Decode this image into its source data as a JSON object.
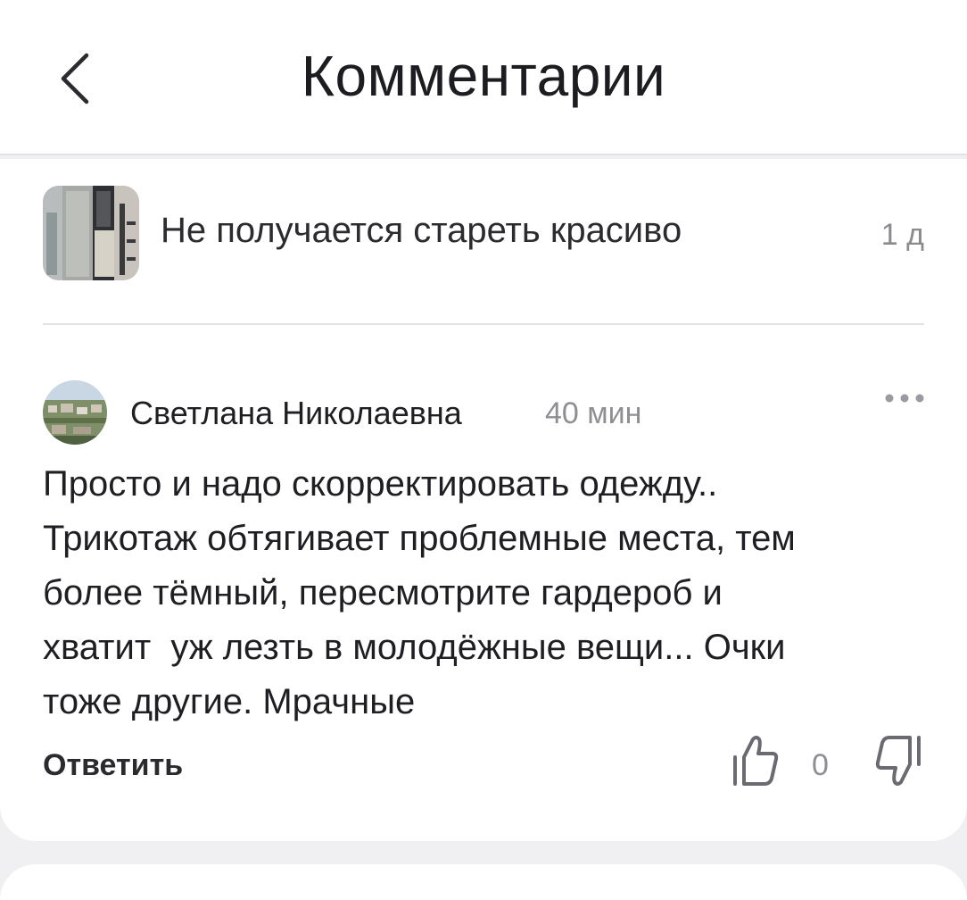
{
  "header": {
    "title": "Комментарии",
    "back_icon": "chevron-left-icon"
  },
  "article": {
    "title": "Не получается стареть красиво",
    "age": "1 д",
    "thumbnail": "article-thumbnail"
  },
  "comment": {
    "author": "Светлана Николаевна",
    "time": "40 мин",
    "text": "Просто и надо скорректировать одежду..\nТрикотаж обтягивает проблемные места, тем\nболее тёмный, пересмотрите гардероб и\nхватит  уж лезть в молодёжные вещи... Очки\nтоже другие. Мрачные",
    "reply_label": "Ответить",
    "likes": "0",
    "more_icon": "more-horizontal-icon",
    "like_icon": "thumbs-up-icon",
    "dislike_icon": "thumbs-down-icon"
  },
  "colors": {
    "background": "#f0f0f3",
    "card": "#ffffff",
    "text_primary": "#1f1f23",
    "text_secondary": "#8e8e93",
    "divider": "#e3e3e7"
  }
}
